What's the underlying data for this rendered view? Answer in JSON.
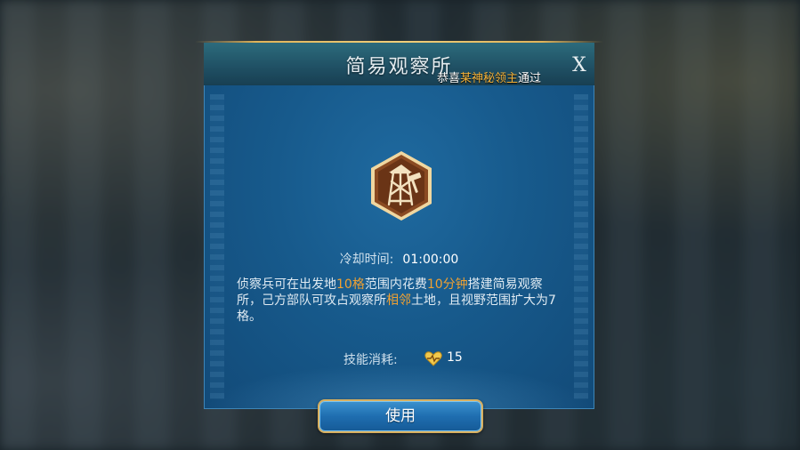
{
  "dialog": {
    "title": "简易观察所",
    "close_label": "X",
    "ticker": {
      "prefix": "恭喜",
      "highlight": "某神秘领主",
      "suffix": "通过"
    },
    "skill_icon": "watchtower-hammer-icon",
    "cooldown": {
      "label": "冷却时间:",
      "value": "01:00:00"
    },
    "description": {
      "p1": "侦察兵可在出发地",
      "h1": "10格",
      "p2": "范围内花费",
      "h2": "10分钟",
      "p3": "搭建简易观察所，己方部队可攻占观察所",
      "h3": "相邻",
      "p4": "土地，且视野范围扩大为7格。"
    },
    "cost": {
      "label": "技能消耗:",
      "icon": "stamina-heart-icon",
      "value": "15"
    },
    "use_button": "使用"
  },
  "colors": {
    "highlight": "#f0a132",
    "ticker_highlight": "#f3b23a",
    "panel_blue": "#175a8c",
    "gold_border": "#d8b060"
  }
}
